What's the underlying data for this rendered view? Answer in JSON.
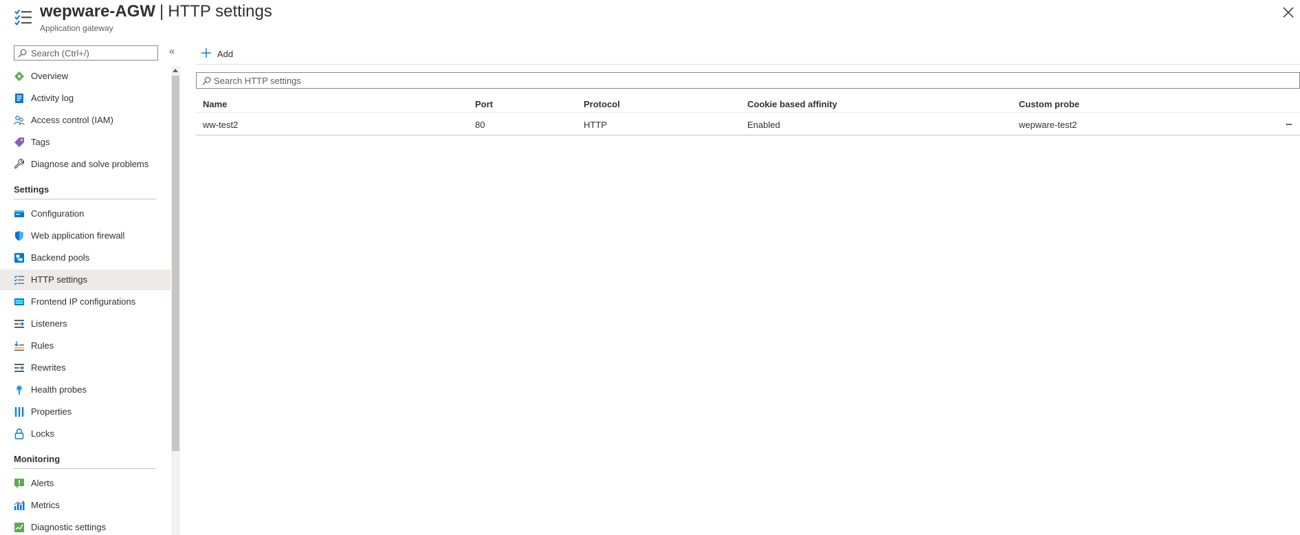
{
  "header": {
    "resource_name": "wepware-AGW",
    "separator": "|",
    "page_title": "HTTP settings",
    "subtitle": "Application gateway"
  },
  "sidebar": {
    "search_placeholder": "Search (Ctrl+/)",
    "collapse_glyph": "«",
    "items": [
      {
        "label": "Overview",
        "icon": "overview-icon"
      },
      {
        "label": "Activity log",
        "icon": "activity-log-icon"
      },
      {
        "label": "Access control (IAM)",
        "icon": "people-icon"
      },
      {
        "label": "Tags",
        "icon": "tag-icon"
      },
      {
        "label": "Diagnose and solve problems",
        "icon": "wrench-icon"
      }
    ],
    "sections": [
      {
        "title": "Settings",
        "items": [
          {
            "label": "Configuration",
            "icon": "configuration-icon"
          },
          {
            "label": "Web application firewall",
            "icon": "shield-icon"
          },
          {
            "label": "Backend pools",
            "icon": "backend-pools-icon"
          },
          {
            "label": "HTTP settings",
            "icon": "list-check-icon",
            "active": true
          },
          {
            "label": "Frontend IP configurations",
            "icon": "frontend-ip-icon"
          },
          {
            "label": "Listeners",
            "icon": "listeners-icon"
          },
          {
            "label": "Rules",
            "icon": "rules-icon"
          },
          {
            "label": "Rewrites",
            "icon": "rewrites-icon"
          },
          {
            "label": "Health probes",
            "icon": "health-probe-icon"
          },
          {
            "label": "Properties",
            "icon": "properties-icon"
          },
          {
            "label": "Locks",
            "icon": "lock-icon"
          }
        ]
      },
      {
        "title": "Monitoring",
        "items": [
          {
            "label": "Alerts",
            "icon": "alert-icon"
          },
          {
            "label": "Metrics",
            "icon": "metrics-icon"
          },
          {
            "label": "Diagnostic settings",
            "icon": "diagnostic-settings-icon"
          }
        ]
      }
    ]
  },
  "toolbar": {
    "add_label": "Add"
  },
  "main": {
    "search_placeholder": "Search HTTP settings",
    "columns": [
      "Name",
      "Port",
      "Protocol",
      "Cookie based affinity",
      "Custom probe"
    ],
    "rows": [
      {
        "name": "ww-test2",
        "port": "80",
        "protocol": "HTTP",
        "cookie_affinity": "Enabled",
        "custom_probe": "wepware-test2",
        "more": "..."
      }
    ]
  },
  "colors": {
    "accent": "#0078d4",
    "active_bg": "#edebe9",
    "text": "#323130",
    "muted": "#605e5c"
  }
}
